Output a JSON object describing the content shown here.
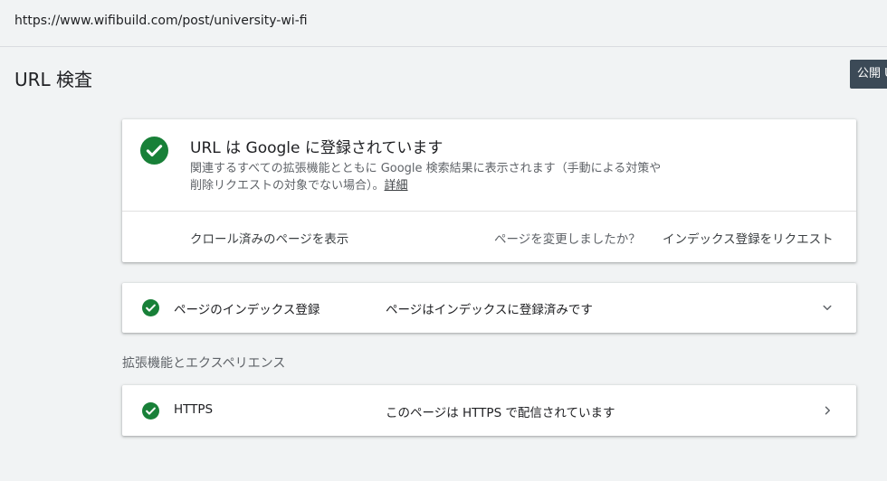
{
  "url_bar": {
    "url": "https://www.wifibuild.com/post/university-wi-fi"
  },
  "header": {
    "title": "URL 検査",
    "publish_button": "公開 U"
  },
  "status_card": {
    "title": "URL は Google に登録されています",
    "description": "関連するすべての拡張機能とともに Google 検索結果に表示されます（手動による対策や削除リクエストの対象でない場合）。",
    "details_link": "詳細",
    "crawled_page_link": "クロール済みのページを表示",
    "page_changed_question": "ページを変更しましたか？",
    "request_indexing_link": "インデックス登録をリクエスト",
    "icon": "check-circle-icon"
  },
  "indexing_card": {
    "label": "ページのインデックス登録",
    "value": "ページはインデックスに登録済みです",
    "icon": "check-circle-icon",
    "expand_icon": "chevron-down-icon"
  },
  "enhancements": {
    "heading": "拡張機能とエクスペリエンス",
    "https_card": {
      "label": "HTTPS",
      "value": "このページは HTTPS で配信されています",
      "icon": "check-circle-icon",
      "open_icon": "chevron-right-icon"
    }
  },
  "colors": {
    "success_green": "#188038",
    "background": "#f1f3f4",
    "publish_button_bg": "#3c4a57"
  }
}
